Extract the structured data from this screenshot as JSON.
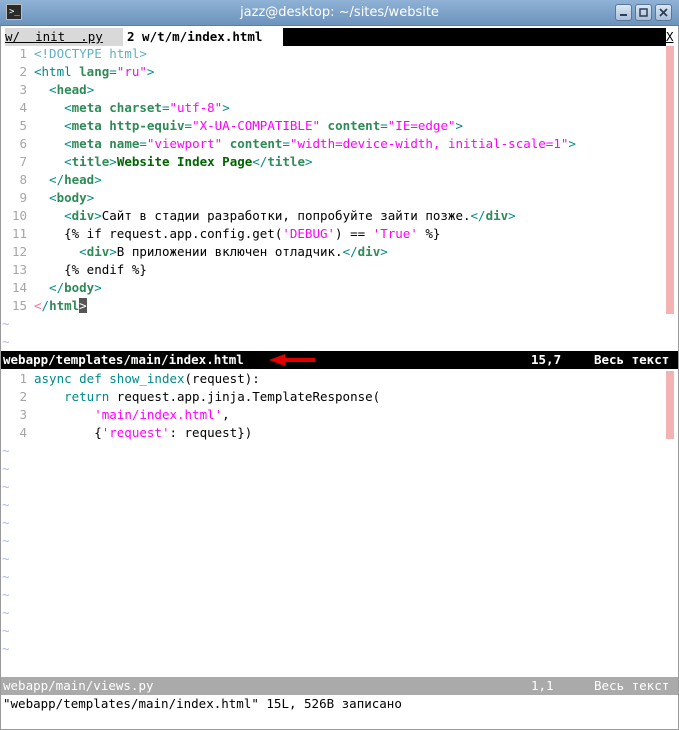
{
  "window": {
    "title": "jazz@desktop: ~/sites/website",
    "icon": "terminal-icon",
    "buttons": [
      "minimize-icon",
      "maximize-icon",
      "close-icon"
    ]
  },
  "tabline": {
    "tabs": [
      {
        "label": "w/  init  .py",
        "active": false
      },
      {
        "label": "2 w/t/m/index.html",
        "active": true
      }
    ],
    "close_label": "X"
  },
  "top_pane": {
    "file": "webapp/templates/main/index.html",
    "position": "15,7",
    "range": "Весь текст",
    "lines": [
      {
        "n": "1",
        "code": "<!DOCTYPE html>"
      },
      {
        "n": "2",
        "code": "<html lang=\"ru\">"
      },
      {
        "n": "3",
        "code": "  <head>"
      },
      {
        "n": "4",
        "code": "    <meta charset=\"utf-8\">"
      },
      {
        "n": "5",
        "code": "    <meta http-equiv=\"X-UA-COMPATIBLE\" content=\"IE=edge\">"
      },
      {
        "n": "6",
        "code": "    <meta name=\"viewport\" content=\"width=device-width, initial-scale=1\">"
      },
      {
        "n": "7",
        "code": "    <title>Website Index Page</title>"
      },
      {
        "n": "8",
        "code": "  </head>"
      },
      {
        "n": "9",
        "code": "  <body>"
      },
      {
        "n": "10",
        "code": "    <div>Сайт в стадии разработки, попробуйте зайти позже.</div>"
      },
      {
        "n": "11",
        "code": "    {% if request.app.config.get('DEBUG') == 'True' %}"
      },
      {
        "n": "12",
        "code": "      <div>В приложении включен отладчик.</div>"
      },
      {
        "n": "13",
        "code": "    {% endif %}"
      },
      {
        "n": "14",
        "code": "  </body>"
      },
      {
        "n": "15",
        "code": "</html>"
      }
    ]
  },
  "bottom_pane": {
    "file": "webapp/main/views.py",
    "position": "1,1",
    "range": "Весь текст",
    "lines": [
      {
        "n": "1",
        "code": "async def show_index(request):"
      },
      {
        "n": "2",
        "code": "    return request.app.jinja.TemplateResponse("
      },
      {
        "n": "3",
        "code": "        'main/index.html',"
      },
      {
        "n": "4",
        "code": "        {'request': request})"
      }
    ]
  },
  "cmdline": "\"webapp/templates/main/index.html\" 15L, 526B записано",
  "tilde": "~",
  "colors": {
    "active_status_bg": "#000000",
    "inactive_status_bg": "#aaaaaa",
    "annotation_arrow": "#e00000",
    "scroll_mark": "#f4b3b3"
  }
}
